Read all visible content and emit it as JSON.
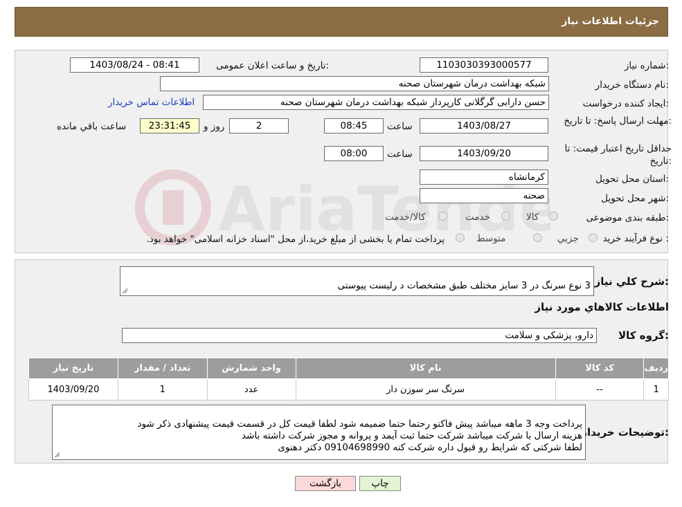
{
  "header": {
    "title": "جزئیات اطلاعات نیاز"
  },
  "form": {
    "need_number_label": "شماره نیاز:",
    "need_number": "1103030393000577",
    "announce_label": "تاریخ و ساعت اعلان عمومی:",
    "announce_value": "1403/08/24 - 08:41",
    "buyer_org_label": "نام دستگاه خریدار:",
    "buyer_org": "شبکه بهداشت درمان شهرستان صحنه",
    "requester_label": "ایجاد کننده درخواست:",
    "requester": "حسن دارابی گرگلانی کارپرداز شبکه بهداشت درمان شهرستان صحنه",
    "contact_link": "اطلاعات تماس خریدار",
    "deadline_label": "مهلت ارسال پاسخ: تا تاریخ:",
    "deadline_date": "1403/08/27",
    "time_label": "ساعت",
    "deadline_time": "08:45",
    "days_count": "2",
    "days_label": "روز و",
    "remaining_time": "23:31:45",
    "remaining_label": "ساعت باقي مانده",
    "validity_label": "حداقل تاریخ اعتبار قیمت: تا تاریخ:",
    "validity_date": "1403/09/20",
    "validity_time": "08:00",
    "province_label": "استان محل تحویل:",
    "province": "کرمانشاه",
    "city_label": "شهر محل تحویل:",
    "city": "صحنه",
    "category_label": "طبقه بندی موضوعی:",
    "category_options": [
      "کالا",
      "خدمت",
      "کالا/خدمت"
    ],
    "process_label": "نوع فرآیند خرید :",
    "process_options": [
      "جزیي",
      "متوسط"
    ],
    "process_note": "پرداخت تمام یا بخشی از مبلغ خرید،از محل \"اسناد خزانه اسلامی\" خواهد بود."
  },
  "summary": {
    "label": "شرح کلي نياز:",
    "value": "3 نوع سرنگ در 3 سایز مختلف طبق مشخصات د رلیست پیوستی"
  },
  "goods": {
    "section_title": "اطلاعات کالاهاي مورد نياز",
    "group_label": "گروه کالا:",
    "group_value": "دارو، پزشکی و سلامت"
  },
  "table": {
    "headers": [
      "ردیف",
      "کد کالا",
      "نام کالا",
      "واحد شمارش",
      "تعداد / مقدار",
      "تاریخ نیاز"
    ],
    "rows": [
      [
        "1",
        "--",
        "سرنگ سر سوزن دار",
        "عدد",
        "1",
        "1403/09/20"
      ]
    ]
  },
  "buyer_notes": {
    "label": "توضیحات خریدار:",
    "value": "پرداخت وجه 3 ماهه میباشد پیش فاکتو رحتما حتما ضمیمه شود لطفا قیمت کل در قسمت قیمت پیشنهادی ذکر شود\nهزینه ارسال با شرکت میباشد  شرکت حتما ثبت آیمد و پروانه و مجوز شرکت داشته باشد\n لطفا شرکتی که شرایط رو قبول داره شرکت کنه   09104698990  دکتر دهنوی"
  },
  "buttons": {
    "print": "چاپ",
    "back": "بازگشت"
  },
  "watermark": {
    "text": "AriaTender.neT"
  },
  "colors": {
    "header_bg": "#8b6c43",
    "table_header": "#9d9d9d",
    "back_button": "#fbd9d9",
    "print_button": "#e3f3d3",
    "link": "#1a3fbf"
  }
}
